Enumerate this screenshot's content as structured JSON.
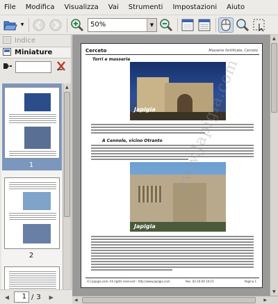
{
  "menu": [
    {
      "label": "File"
    },
    {
      "label": "Modifica"
    },
    {
      "label": "Visualizza"
    },
    {
      "label": "Vai"
    },
    {
      "label": "Strumenti"
    },
    {
      "label": "Impostazioni"
    },
    {
      "label": "Aiuto"
    }
  ],
  "toolbar": {
    "zoom_value": "50%",
    "icons": [
      "open-icon",
      "back-icon",
      "forward-icon",
      "zoom-in-icon",
      "zoom-out-icon",
      "single-page-icon",
      "facing-pages-icon",
      "browse-tool-icon",
      "magnifier-tool-icon",
      "select-tool-icon"
    ]
  },
  "sidebar": {
    "tabs": [
      {
        "label": "Indice",
        "state": "disabled"
      },
      {
        "label": "Miniature",
        "state": "selected"
      }
    ],
    "thumbnails": [
      {
        "number": "1",
        "selected": true
      },
      {
        "number": "2",
        "selected": false
      }
    ]
  },
  "page_nav": {
    "current": "1",
    "separator": "/",
    "total": "3"
  },
  "document": {
    "header_left": "Cerceto",
    "header_right": "Masserie fortificate, Cerceto",
    "section1_title": "Torri e masserie",
    "section2_title": "A Cennole, vicino Otranto",
    "watermark": "www.Japigia.com",
    "photo_caption": "Japigia",
    "footer_left": "(C) Japigia.com, All rights reserved - http://www.Japigia.com",
    "footer_mid": "Rev. 02-10-04 10:15",
    "footer_right": "Pagina 1"
  },
  "colors": {
    "accent": "#7b97bd",
    "doc_background": "#9a9a9a",
    "sky": "#1e3a78"
  }
}
